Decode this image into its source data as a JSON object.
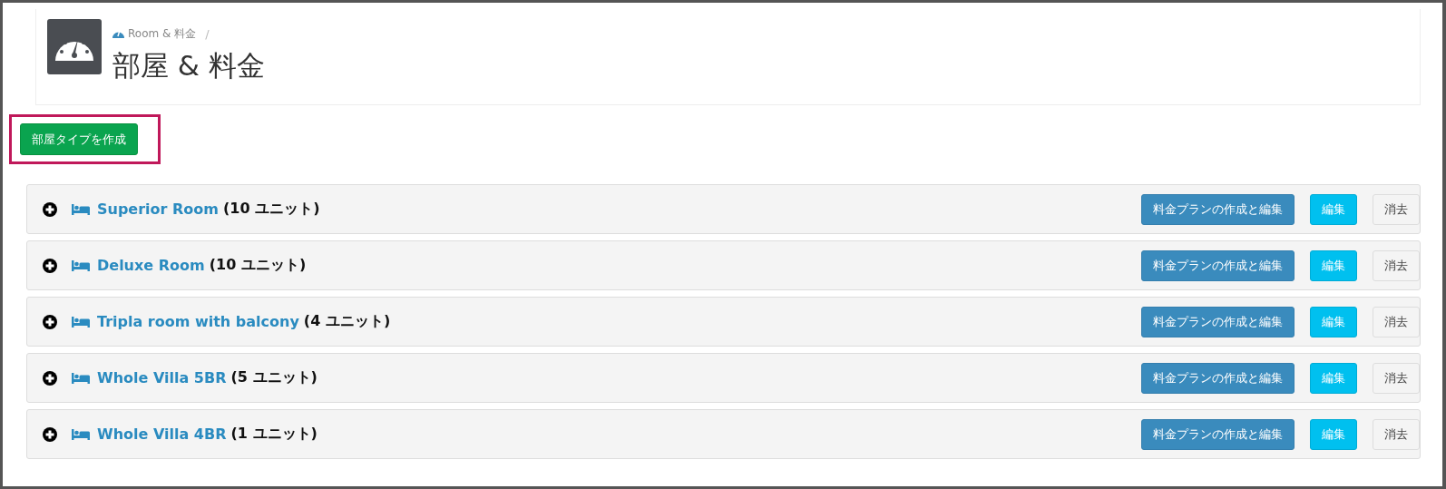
{
  "header": {
    "breadcrumb": "Room & 料金",
    "separator": "/",
    "title": "部屋 & 料金"
  },
  "create_button": {
    "label": "部屋タイプを作成",
    "highlighted": true
  },
  "rooms": [
    {
      "name": "Superior Room",
      "units": "(10 ユニット)",
      "expanded": false,
      "rate_button": "料金プランの作成と編集",
      "edit_button": "編集",
      "delete_button": "消去"
    },
    {
      "name": "Deluxe Room",
      "units": "(10 ユニット)",
      "expanded": false,
      "rate_button": "料金プランの作成と編集",
      "edit_button": "編集",
      "delete_button": "消去"
    },
    {
      "name": "Tripla room with balcony",
      "units": "(4 ユニット)",
      "expanded": false,
      "rate_button": "料金プランの作成と編集",
      "edit_button": "編集",
      "delete_button": "消去"
    },
    {
      "name": "Whole Villa 5BR",
      "units": "(5 ユニット)",
      "expanded": false,
      "rate_button": "料金プランの作成と編集",
      "edit_button": "編集",
      "delete_button": "消去"
    },
    {
      "name": "Whole Villa 4BR",
      "units": "(1 ユニット)",
      "expanded": false,
      "rate_button": "料金プランの作成と編集",
      "edit_button": "編集",
      "delete_button": "消去"
    }
  ]
}
